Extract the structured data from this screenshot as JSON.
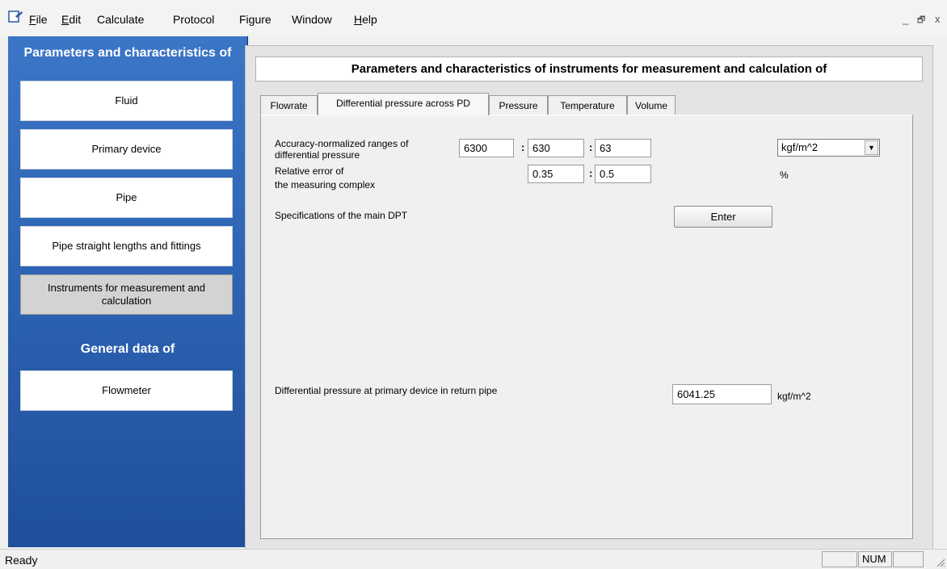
{
  "menu": {
    "items": [
      {
        "accel": "F",
        "rest": "ile"
      },
      {
        "accel": "E",
        "rest": "dit"
      },
      {
        "accel": "",
        "rest": "Calculate"
      },
      {
        "accel": "",
        "rest": "Protocol"
      },
      {
        "accel": "",
        "rest": "Figure"
      },
      {
        "accel": "",
        "rest": "Window"
      },
      {
        "accel": "H",
        "rest": "elp"
      }
    ],
    "window_controls": [
      "_",
      "🗗",
      "x"
    ]
  },
  "sidebar": {
    "heading1": "Parameters and characteristics of",
    "buttons": [
      {
        "label": "Fluid"
      },
      {
        "label": "Primary device"
      },
      {
        "label": "Pipe"
      },
      {
        "label": "Pipe straight lengths and fittings"
      },
      {
        "label": "Instruments for measurement and calculation"
      }
    ],
    "heading2": "General data of",
    "general_button": "Flowmeter"
  },
  "main": {
    "title": "Parameters and characteristics of instruments for measurement and calculation of",
    "tabs": [
      {
        "label": "Flowrate"
      },
      {
        "label": "Differential pressure across PD",
        "selected": true
      },
      {
        "label": "Pressure"
      },
      {
        "label": "Temperature"
      },
      {
        "label": "Volume"
      }
    ],
    "ranges_label": "Accuracy-normalized ranges of differential pressure",
    "ranges": [
      "6300",
      "630",
      "63"
    ],
    "unit_select": "kgf/m^2",
    "error_label_line1": "Relative error of",
    "error_label_line2": "the measuring complex",
    "errors": [
      "0.35",
      "0.5"
    ],
    "error_unit": "%",
    "dpt_label": "Specifications of the main DPT",
    "enter_button": "Enter",
    "dp_label": "Differential pressure at primary device in return pipe",
    "dp_value": "6041.25",
    "dp_unit": "kgf/m^2",
    "separator": ":"
  },
  "status": {
    "text": "Ready",
    "num": "NUM"
  }
}
